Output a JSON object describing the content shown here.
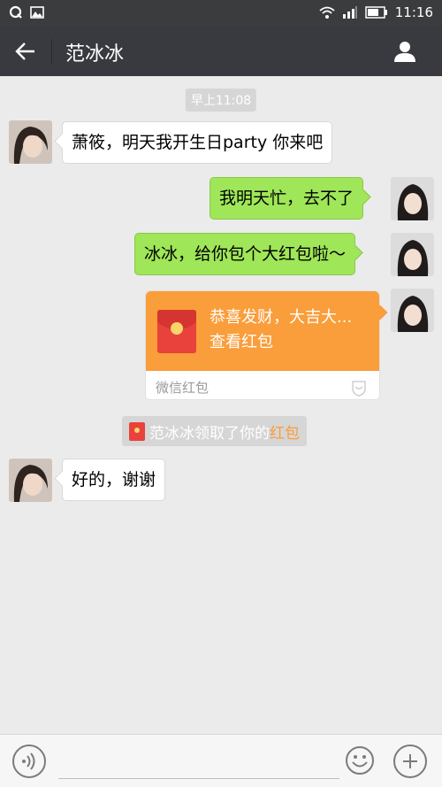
{
  "status_bar": {
    "time": "11:16",
    "left_icons": [
      "notification-q-icon",
      "image-icon"
    ],
    "right_icons": [
      "wifi-icon",
      "signal-icon",
      "battery-icon"
    ]
  },
  "header": {
    "back_icon": "back-arrow-icon",
    "title": "范冰冰",
    "profile_icon": "person-icon"
  },
  "chat": {
    "timestamp": "早上11:08",
    "messages": [
      {
        "side": "left",
        "text": "萧筱，明天我开生日party 你来吧"
      },
      {
        "side": "right",
        "text": "我明天忙，去不了"
      },
      {
        "side": "right",
        "text": "冰冰，给你包个大红包啦～"
      },
      {
        "side": "left",
        "text": "好的，谢谢"
      }
    ],
    "red_packet": {
      "title": "恭喜发财，大吉大...",
      "action": "查看红包",
      "footer": "微信红包"
    },
    "system_notice": {
      "text": "范冰冰领取了你的",
      "link": "红包"
    }
  },
  "input_bar": {
    "voice_icon": "voice-icon",
    "input_value": "",
    "emoji_icon": "emoji-icon",
    "plus_icon": "plus-icon"
  },
  "colors": {
    "header_bg": "#393a3f",
    "chat_bg": "#ebebeb",
    "own_bubble": "#9fe658",
    "red_packet": "#fa9d3b",
    "link": "#fa9d3b"
  }
}
